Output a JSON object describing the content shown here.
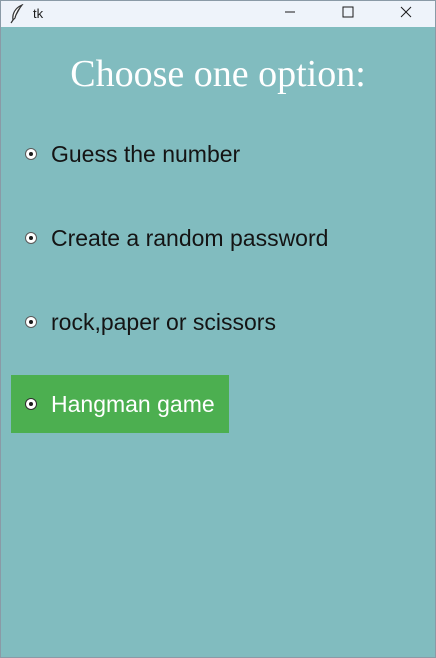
{
  "window": {
    "title": "tk",
    "icons": {
      "app": "feather-icon",
      "minimize": "minimize-icon",
      "maximize": "maximize-icon",
      "close": "close-icon"
    }
  },
  "main": {
    "heading": "Choose one option:",
    "background_color": "#81bcbf",
    "active_color": "#4caf50",
    "options": [
      {
        "label": "Guess the number",
        "active": false
      },
      {
        "label": "Create a random password",
        "active": false
      },
      {
        "label": "rock,paper or scissors",
        "active": false
      },
      {
        "label": "Hangman game",
        "active": true
      }
    ]
  }
}
